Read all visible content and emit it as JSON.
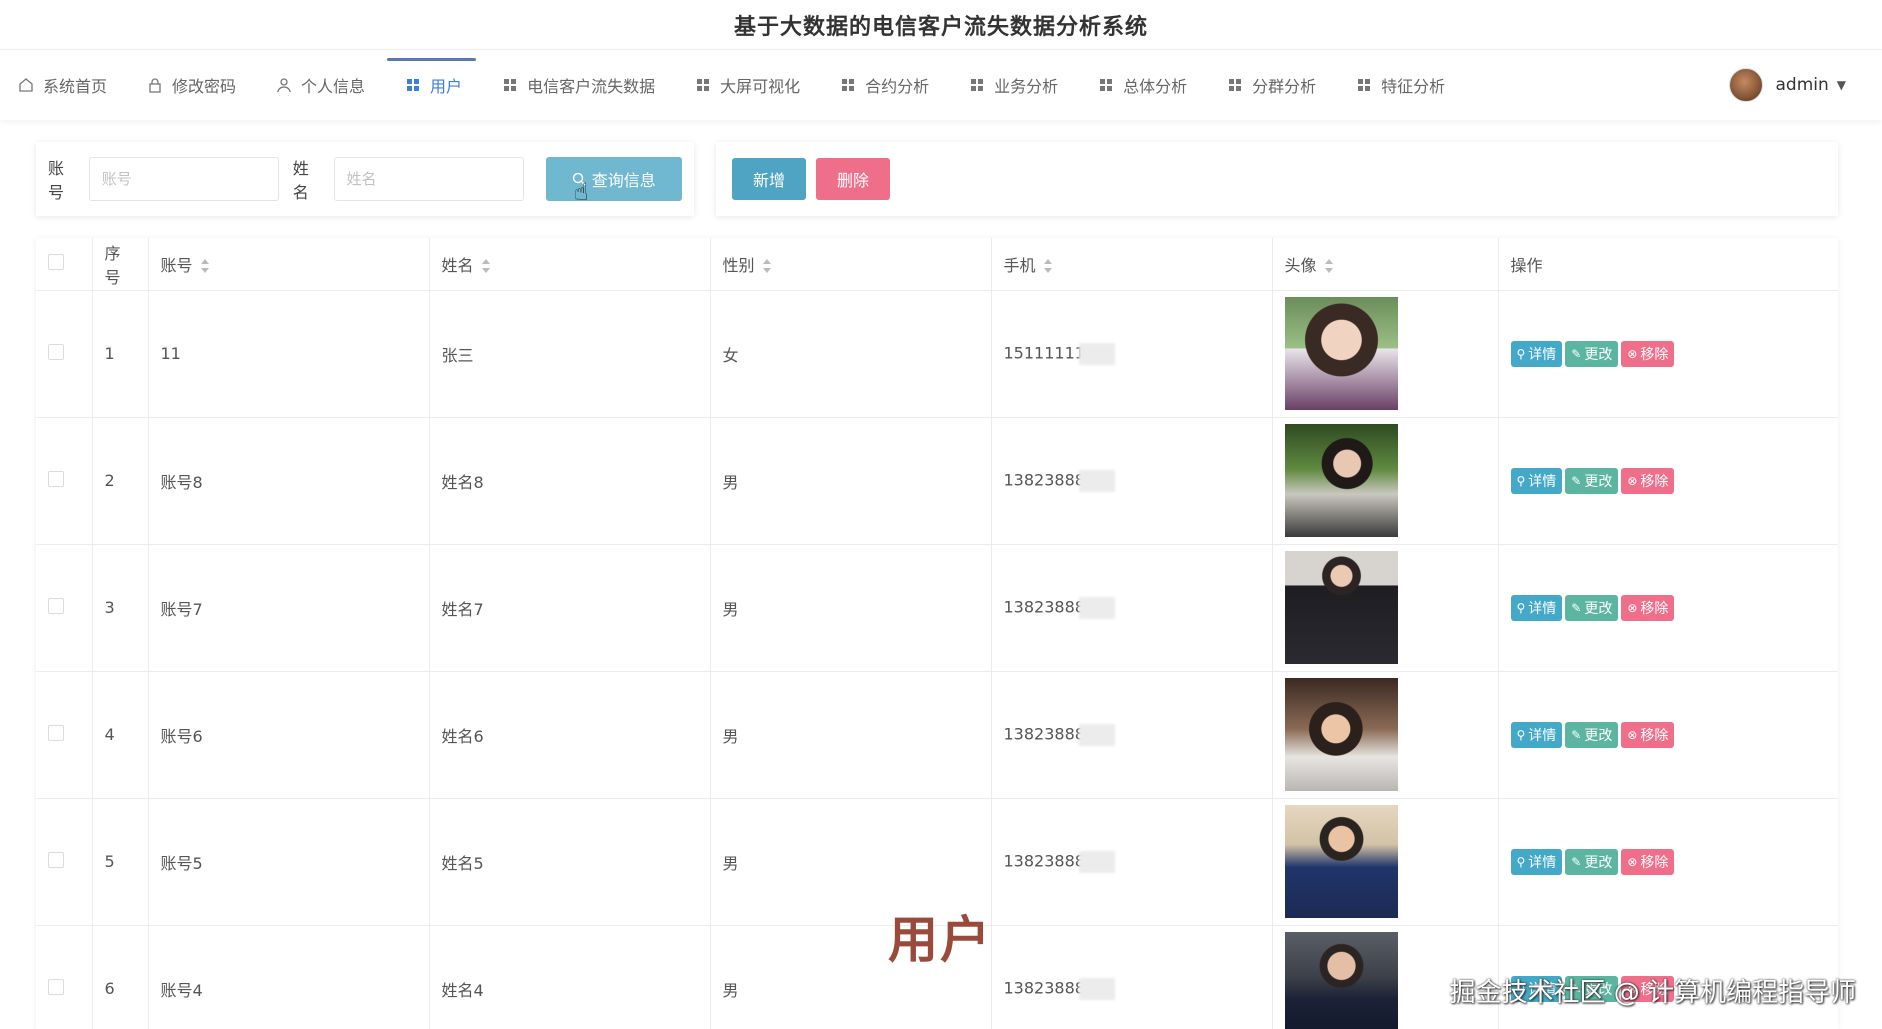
{
  "app": {
    "title": "基于大数据的电信客户流失数据分析系统"
  },
  "nav": {
    "items": [
      {
        "label": "系统首页",
        "icon": "home-icon"
      },
      {
        "label": "修改密码",
        "icon": "lock-icon"
      },
      {
        "label": "个人信息",
        "icon": "person-icon"
      },
      {
        "label": "用户",
        "icon": "grid-icon",
        "active": true
      },
      {
        "label": "电信客户流失数据",
        "icon": "grid-icon"
      },
      {
        "label": "大屏可视化",
        "icon": "grid-icon"
      },
      {
        "label": "合约分析",
        "icon": "grid-icon"
      },
      {
        "label": "业务分析",
        "icon": "grid-icon"
      },
      {
        "label": "总体分析",
        "icon": "grid-icon"
      },
      {
        "label": "分群分析",
        "icon": "grid-icon"
      },
      {
        "label": "特征分析",
        "icon": "grid-icon"
      }
    ],
    "user": {
      "name": "admin"
    }
  },
  "search": {
    "account_label": "账号",
    "account_placeholder": "账号",
    "name_label": "姓名",
    "name_placeholder": "姓名",
    "query_button": "查询信息"
  },
  "actions": {
    "add": "新增",
    "delete": "删除"
  },
  "table": {
    "headers": {
      "index": "序号",
      "account": "账号",
      "name": "姓名",
      "gender": "性别",
      "phone": "手机",
      "avatar": "头像",
      "ops": "操作"
    },
    "ops": {
      "detail": "详情",
      "edit": "更改",
      "remove": "移除"
    },
    "rows": [
      {
        "index": "1",
        "account": "11",
        "name": "张三",
        "gender": "女",
        "phone": "15111111"
      },
      {
        "index": "2",
        "account": "账号8",
        "name": "姓名8",
        "gender": "男",
        "phone": "13823888"
      },
      {
        "index": "3",
        "account": "账号7",
        "name": "姓名7",
        "gender": "男",
        "phone": "13823888"
      },
      {
        "index": "4",
        "account": "账号6",
        "name": "姓名6",
        "gender": "男",
        "phone": "13823888"
      },
      {
        "index": "5",
        "account": "账号5",
        "name": "姓名5",
        "gender": "男",
        "phone": "13823888"
      },
      {
        "index": "6",
        "account": "账号4",
        "name": "姓名4",
        "gender": "男",
        "phone": "13823888"
      }
    ]
  },
  "overlay": {
    "caption": "用户",
    "watermark": "掘金技术社区 @ 计算机编程指导师"
  },
  "colors": {
    "accent": "#3c7de0",
    "search_btn": "#6fb8cf",
    "add_btn": "#4fa4c4",
    "delete_btn": "#ef6f8b"
  }
}
